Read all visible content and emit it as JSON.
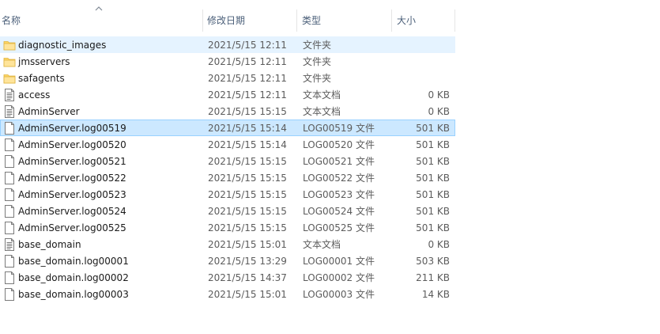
{
  "columns": {
    "name": "名称",
    "modified": "修改日期",
    "type": "类型",
    "size": "大小"
  },
  "sort_icon": "sort-ascending-icon",
  "colors": {
    "folder": "#ffd766",
    "selected_bg": "#cce8ff",
    "selected_border": "#99d1ff",
    "hover_bg": "#e5f3ff",
    "header_text": "#4c607a"
  },
  "files": [
    {
      "name": "diagnostic_images",
      "modified": "2021/5/15 12:11",
      "type": "文件夹",
      "size": "",
      "icon": "folder-icon",
      "state": "hover"
    },
    {
      "name": "jmsservers",
      "modified": "2021/5/15 12:11",
      "type": "文件夹",
      "size": "",
      "icon": "folder-icon",
      "state": ""
    },
    {
      "name": "safagents",
      "modified": "2021/5/15 12:11",
      "type": "文件夹",
      "size": "",
      "icon": "folder-icon",
      "state": ""
    },
    {
      "name": "access",
      "modified": "2021/5/15 12:11",
      "type": "文本文档",
      "size": "0 KB",
      "icon": "text-file-icon",
      "state": ""
    },
    {
      "name": "AdminServer",
      "modified": "2021/5/15 15:15",
      "type": "文本文档",
      "size": "0 KB",
      "icon": "text-file-icon",
      "state": ""
    },
    {
      "name": "AdminServer.log00519",
      "modified": "2021/5/15 15:14",
      "type": "LOG00519 文件",
      "size": "501 KB",
      "icon": "blank-file-icon",
      "state": "selected"
    },
    {
      "name": "AdminServer.log00520",
      "modified": "2021/5/15 15:14",
      "type": "LOG00520 文件",
      "size": "501 KB",
      "icon": "blank-file-icon",
      "state": ""
    },
    {
      "name": "AdminServer.log00521",
      "modified": "2021/5/15 15:15",
      "type": "LOG00521 文件",
      "size": "501 KB",
      "icon": "blank-file-icon",
      "state": ""
    },
    {
      "name": "AdminServer.log00522",
      "modified": "2021/5/15 15:15",
      "type": "LOG00522 文件",
      "size": "501 KB",
      "icon": "blank-file-icon",
      "state": ""
    },
    {
      "name": "AdminServer.log00523",
      "modified": "2021/5/15 15:15",
      "type": "LOG00523 文件",
      "size": "501 KB",
      "icon": "blank-file-icon",
      "state": ""
    },
    {
      "name": "AdminServer.log00524",
      "modified": "2021/5/15 15:15",
      "type": "LOG00524 文件",
      "size": "501 KB",
      "icon": "blank-file-icon",
      "state": ""
    },
    {
      "name": "AdminServer.log00525",
      "modified": "2021/5/15 15:15",
      "type": "LOG00525 文件",
      "size": "501 KB",
      "icon": "blank-file-icon",
      "state": ""
    },
    {
      "name": "base_domain",
      "modified": "2021/5/15 15:01",
      "type": "文本文档",
      "size": "0 KB",
      "icon": "text-file-icon",
      "state": ""
    },
    {
      "name": "base_domain.log00001",
      "modified": "2021/5/15 13:29",
      "type": "LOG00001 文件",
      "size": "503 KB",
      "icon": "blank-file-icon",
      "state": ""
    },
    {
      "name": "base_domain.log00002",
      "modified": "2021/5/15 14:37",
      "type": "LOG00002 文件",
      "size": "211 KB",
      "icon": "blank-file-icon",
      "state": ""
    },
    {
      "name": "base_domain.log00003",
      "modified": "2021/5/15 15:01",
      "type": "LOG00003 文件",
      "size": "14 KB",
      "icon": "blank-file-icon",
      "state": ""
    }
  ]
}
